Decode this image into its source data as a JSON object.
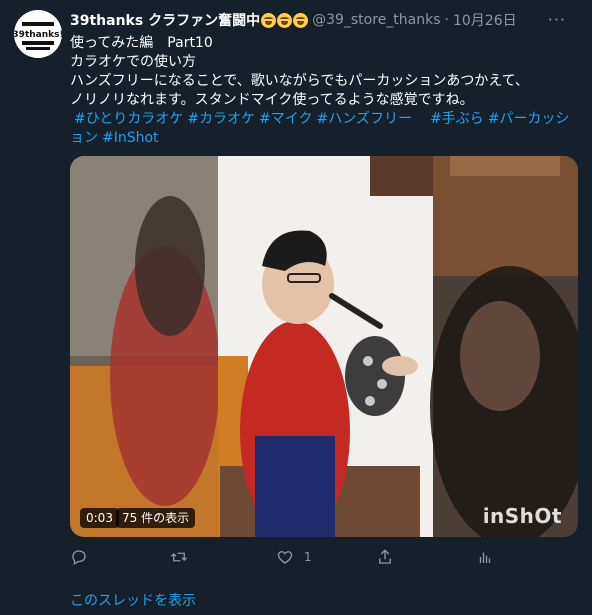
{
  "tweet": {
    "avatar_text": "39thanks!",
    "display_name": "39thanks クラファン奮闘中",
    "handle": "@39_store_thanks",
    "dot": "·",
    "date": "10月26日",
    "more": "···",
    "lines": [
      "使ってみた編　Part10",
      "カラオケでの使い方",
      "ハンズフリーになることで、歌いながらでもパーカッションあつかえて、",
      "ノリノリなれます。スタンドマイク使ってるような感覚ですね。"
    ],
    "hashtags_line1": [
      "#ひとりカラオケ",
      "#カラオケ",
      "#マイク",
      "#ハンズフリー",
      "　#手ぶら",
      "#パーカッシ"
    ],
    "hashtags_line2": [
      "ョン",
      "#InShot"
    ]
  },
  "media": {
    "time": "0:03",
    "views": "75 件の表示",
    "watermark": "inShOt"
  },
  "actions": {
    "reply_count": "",
    "retweet_count": "",
    "like_count": "1",
    "share_count": ""
  },
  "thread": {
    "link_text": "このスレッドを表示"
  },
  "colors": {
    "background": "#15202b",
    "text": "#ffffff",
    "muted": "#8899a6",
    "link": "#1da1f2"
  }
}
